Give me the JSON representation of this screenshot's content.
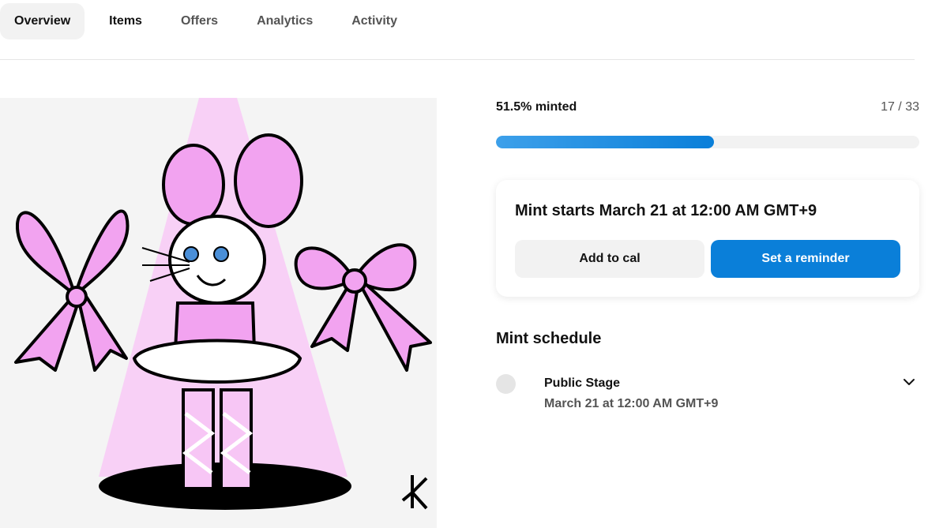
{
  "tabs": [
    {
      "label": "Overview",
      "active": true
    },
    {
      "label": "Items",
      "active": false
    },
    {
      "label": "Offers",
      "active": false
    },
    {
      "label": "Analytics",
      "active": false
    },
    {
      "label": "Activity",
      "active": false
    }
  ],
  "progress": {
    "label": "51.5% minted",
    "count": "17 / 33",
    "fraction": 0.515
  },
  "mint_card": {
    "title": "Mint starts March 21 at 12:00 AM GMT+9",
    "add_to_cal_label": "Add to cal",
    "reminder_label": "Set a reminder"
  },
  "schedule": {
    "heading": "Mint schedule",
    "stages": [
      {
        "name": "Public Stage",
        "date": "March 21 at 12:00 AM GMT+9"
      }
    ]
  },
  "icons": {
    "expand": "chevron-down-icon"
  },
  "colors": {
    "accent": "#0a7fd9",
    "progress_track": "#f2f2f2",
    "artwork_pink": "#f2a3f0"
  }
}
